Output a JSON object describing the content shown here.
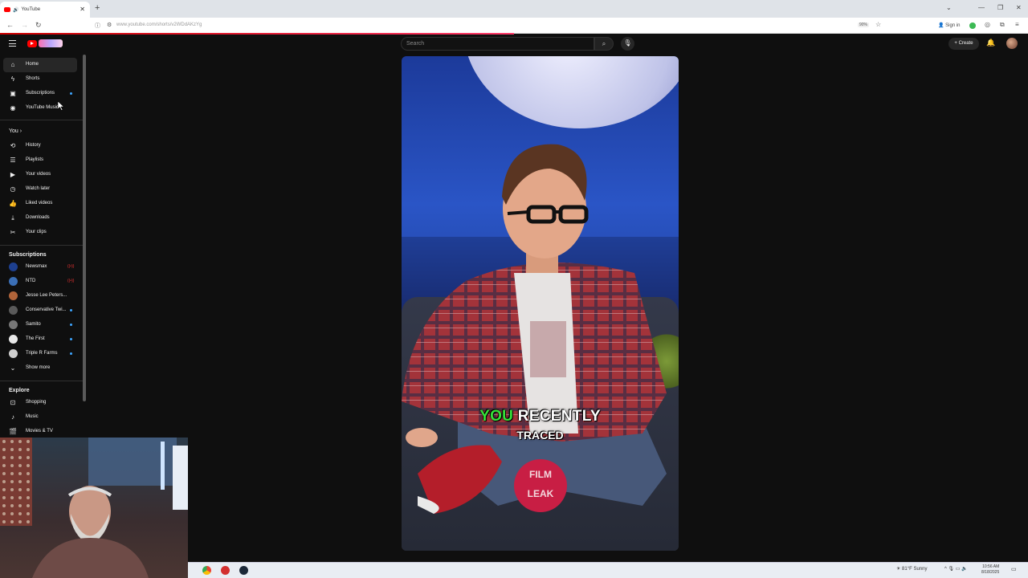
{
  "browser": {
    "tab_title": "YouTube",
    "new_tab_glyph": "+",
    "url": "www.youtube.com/shorts/v2WDdAKzYg",
    "zoom": "90%",
    "sign_in": "Sign in",
    "loading_progress": 0.5
  },
  "header": {
    "search_placeholder": "Search",
    "create_label": "Create"
  },
  "sidebar": {
    "main": [
      {
        "label": "Home",
        "icon": "home-icon",
        "active": true
      },
      {
        "label": "Shorts",
        "icon": "shorts-icon"
      },
      {
        "label": "Subscriptions",
        "icon": "subscriptions-icon",
        "dot": true
      },
      {
        "label": "YouTube Music",
        "icon": "music-icon"
      }
    ],
    "you_heading": "You",
    "you": [
      {
        "label": "History",
        "icon": "history-icon"
      },
      {
        "label": "Playlists",
        "icon": "playlists-icon"
      },
      {
        "label": "Your videos",
        "icon": "your-videos-icon"
      },
      {
        "label": "Watch later",
        "icon": "watch-later-icon"
      },
      {
        "label": "Liked videos",
        "icon": "thumbs-up-icon"
      },
      {
        "label": "Downloads",
        "icon": "download-icon"
      },
      {
        "label": "Your clips",
        "icon": "scissors-icon"
      }
    ],
    "subscriptions_heading": "Subscriptions",
    "subscriptions": [
      {
        "label": "Newsmax",
        "color": "#1d3f8f",
        "live": true
      },
      {
        "label": "NTD",
        "color": "#3b6fb6",
        "live": true
      },
      {
        "label": "Jesse Lee Peters...",
        "color": "#b0643a"
      },
      {
        "label": "Conservative Twi...",
        "color": "#5a5a5a",
        "dot": true
      },
      {
        "label": "Samito",
        "color": "#777777",
        "dot": true
      },
      {
        "label": "The First",
        "color": "#e8e8e8",
        "dot": true
      },
      {
        "label": "Triple R Farms",
        "color": "#cfcfcf",
        "dot": true
      }
    ],
    "show_more": "Show more",
    "explore_heading": "Explore",
    "explore": [
      {
        "label": "Shopping",
        "icon": "shopping-bag-icon"
      },
      {
        "label": "Music",
        "icon": "music-note-icon"
      },
      {
        "label": "Movies & TV",
        "icon": "movie-icon"
      }
    ]
  },
  "video": {
    "caption_highlight": "YOU",
    "caption_rest": "RECENTLY",
    "caption_line2": "TRACED",
    "badge_top": "FILM",
    "badge_bottom": "LEAK"
  },
  "taskbar": {
    "weather": "81°F  Sunny",
    "time": "10:56 AM",
    "date": "8/18/2025"
  }
}
